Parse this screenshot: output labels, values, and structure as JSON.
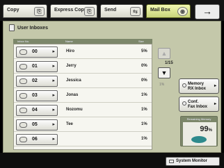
{
  "tabs": [
    {
      "label": "Copy",
      "icon": "copy-icon"
    },
    {
      "label": "Express Copy",
      "icon": "express-copy-icon"
    },
    {
      "label": "Send",
      "icon": "send-icon"
    },
    {
      "label": "Mail Box",
      "icon": "mail-box-icon",
      "active": true
    }
  ],
  "next_arrow": "→",
  "title": "User Inboxes",
  "list_header": {
    "col_no": "Inbox No.",
    "col_name": "Name",
    "col_size": "Size"
  },
  "inboxes": [
    {
      "number": "00",
      "name": "Hiro",
      "size": "5%"
    },
    {
      "number": "01",
      "name": "Jerry",
      "size": "0%"
    },
    {
      "number": "02",
      "name": "Jessica",
      "size": "0%"
    },
    {
      "number": "03",
      "name": "Jonas",
      "size": "1%"
    },
    {
      "number": "04",
      "name": "Nozomu",
      "size": "1%"
    },
    {
      "number": "05",
      "name": "Tee",
      "size": "1%"
    },
    {
      "number": "06",
      "name": "",
      "size": "1%"
    }
  ],
  "box_arrow": "▸",
  "scroll": {
    "up": "▲",
    "down": "▼",
    "page": "1/15",
    "mark": "1%"
  },
  "side_buttons": {
    "memory_rx": {
      "line1": "Memory",
      "line2": "RX Inbox",
      "arrow": "▸"
    },
    "conf_fax": {
      "line1": "Conf.",
      "line2": "Fax Inbox",
      "arrow": "▸"
    }
  },
  "memory": {
    "label": "Remaining Memory",
    "value": "99",
    "unit": "%"
  },
  "system_monitor": "System Monitor",
  "colors": {
    "panel": "#c4c8aa",
    "header": "#7c876a",
    "active_tab": "#c8d47a",
    "memory_cylinder": "#2e8a8c"
  }
}
